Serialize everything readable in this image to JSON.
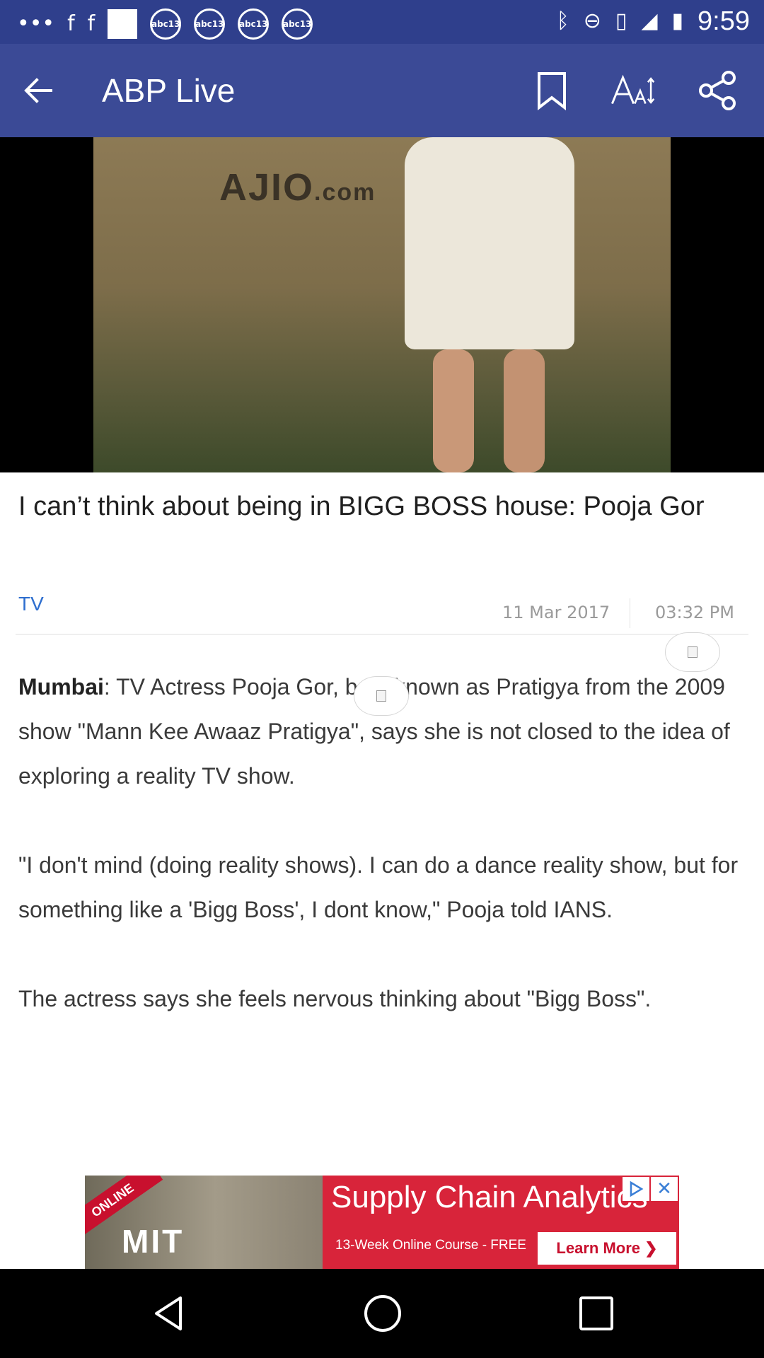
{
  "status_bar": {
    "time": "9:59",
    "notification_icons": [
      "more-icon",
      "facebook-icon",
      "facebook-icon",
      "image-icon",
      "abc13-icon",
      "abc13-icon",
      "abc13-icon",
      "abc13-icon"
    ],
    "abc_label": "abc13",
    "system_icons": [
      "bluetooth-icon",
      "do-not-disturb-icon",
      "vibrate-icon",
      "signal-icon",
      "battery-icon"
    ]
  },
  "app_bar": {
    "title": "ABP Live",
    "actions": [
      "bookmark-icon",
      "font-size-icon",
      "share-icon"
    ]
  },
  "hero": {
    "brand_text": "AJIO",
    "brand_suffix": ".com"
  },
  "article": {
    "headline": "I can’t think about being in BIGG BOSS house: Pooja Gor",
    "category": "TV",
    "date": "11 Mar 2017",
    "time": "03:32 PM",
    "paragraphs": [
      {
        "lead": "Mumbai",
        "text": ": TV Actress Pooja Gor, best known as Pratigya from the 2009 show \"Mann Kee Awaaz Pratigya\", says she is not closed to the idea of exploring a reality TV show."
      },
      {
        "lead": "",
        "text": "\"I don't mind (doing reality shows). I can do a dance reality show, but for something like a 'Bigg Boss', I dont know,\" Pooja told IANS."
      },
      {
        "lead": "",
        "text": "The actress says she feels nervous thinking about \"Bigg Boss\"."
      }
    ]
  },
  "ad": {
    "ribbon": "ONLINE",
    "logo": "MIT",
    "title": "Supply Chain Analytics",
    "subtitle": "13-Week Online Course - FREE",
    "cta": "Learn More ❯",
    "close": "✕"
  },
  "colors": {
    "status_bar": "#2f3f8c",
    "app_bar": "#3b4a96",
    "category": "#2f6fcf",
    "ad_red": "#d8243a"
  }
}
